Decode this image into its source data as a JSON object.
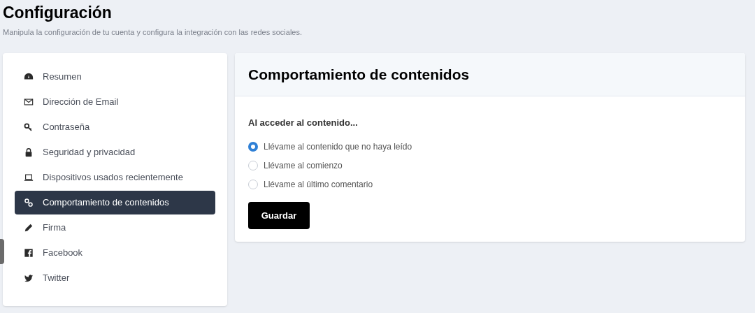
{
  "page": {
    "title": "Configuración",
    "subtitle": "Manipula la configuración de tu cuenta y configura la integración con las redes sociales."
  },
  "sidebar": {
    "items": [
      {
        "label": "Resumen",
        "selected": false
      },
      {
        "label": "Dirección de Email",
        "selected": false
      },
      {
        "label": "Contraseña",
        "selected": false
      },
      {
        "label": "Seguridad y privacidad",
        "selected": false
      },
      {
        "label": "Dispositivos usados recientemente",
        "selected": false
      },
      {
        "label": "Comportamiento de contenidos",
        "selected": true
      },
      {
        "label": "Firma",
        "selected": false
      },
      {
        "label": "Facebook",
        "selected": false
      },
      {
        "label": "Twitter",
        "selected": false
      }
    ]
  },
  "panel": {
    "title": "Comportamiento de contenidos",
    "question": "Al acceder al contenido...",
    "options": [
      {
        "label": "Llévame al contenido que no haya leído",
        "selected": true
      },
      {
        "label": "Llévame al comienzo",
        "selected": false
      },
      {
        "label": "Llévame al último comentario",
        "selected": false
      }
    ],
    "button": "Guardar"
  }
}
